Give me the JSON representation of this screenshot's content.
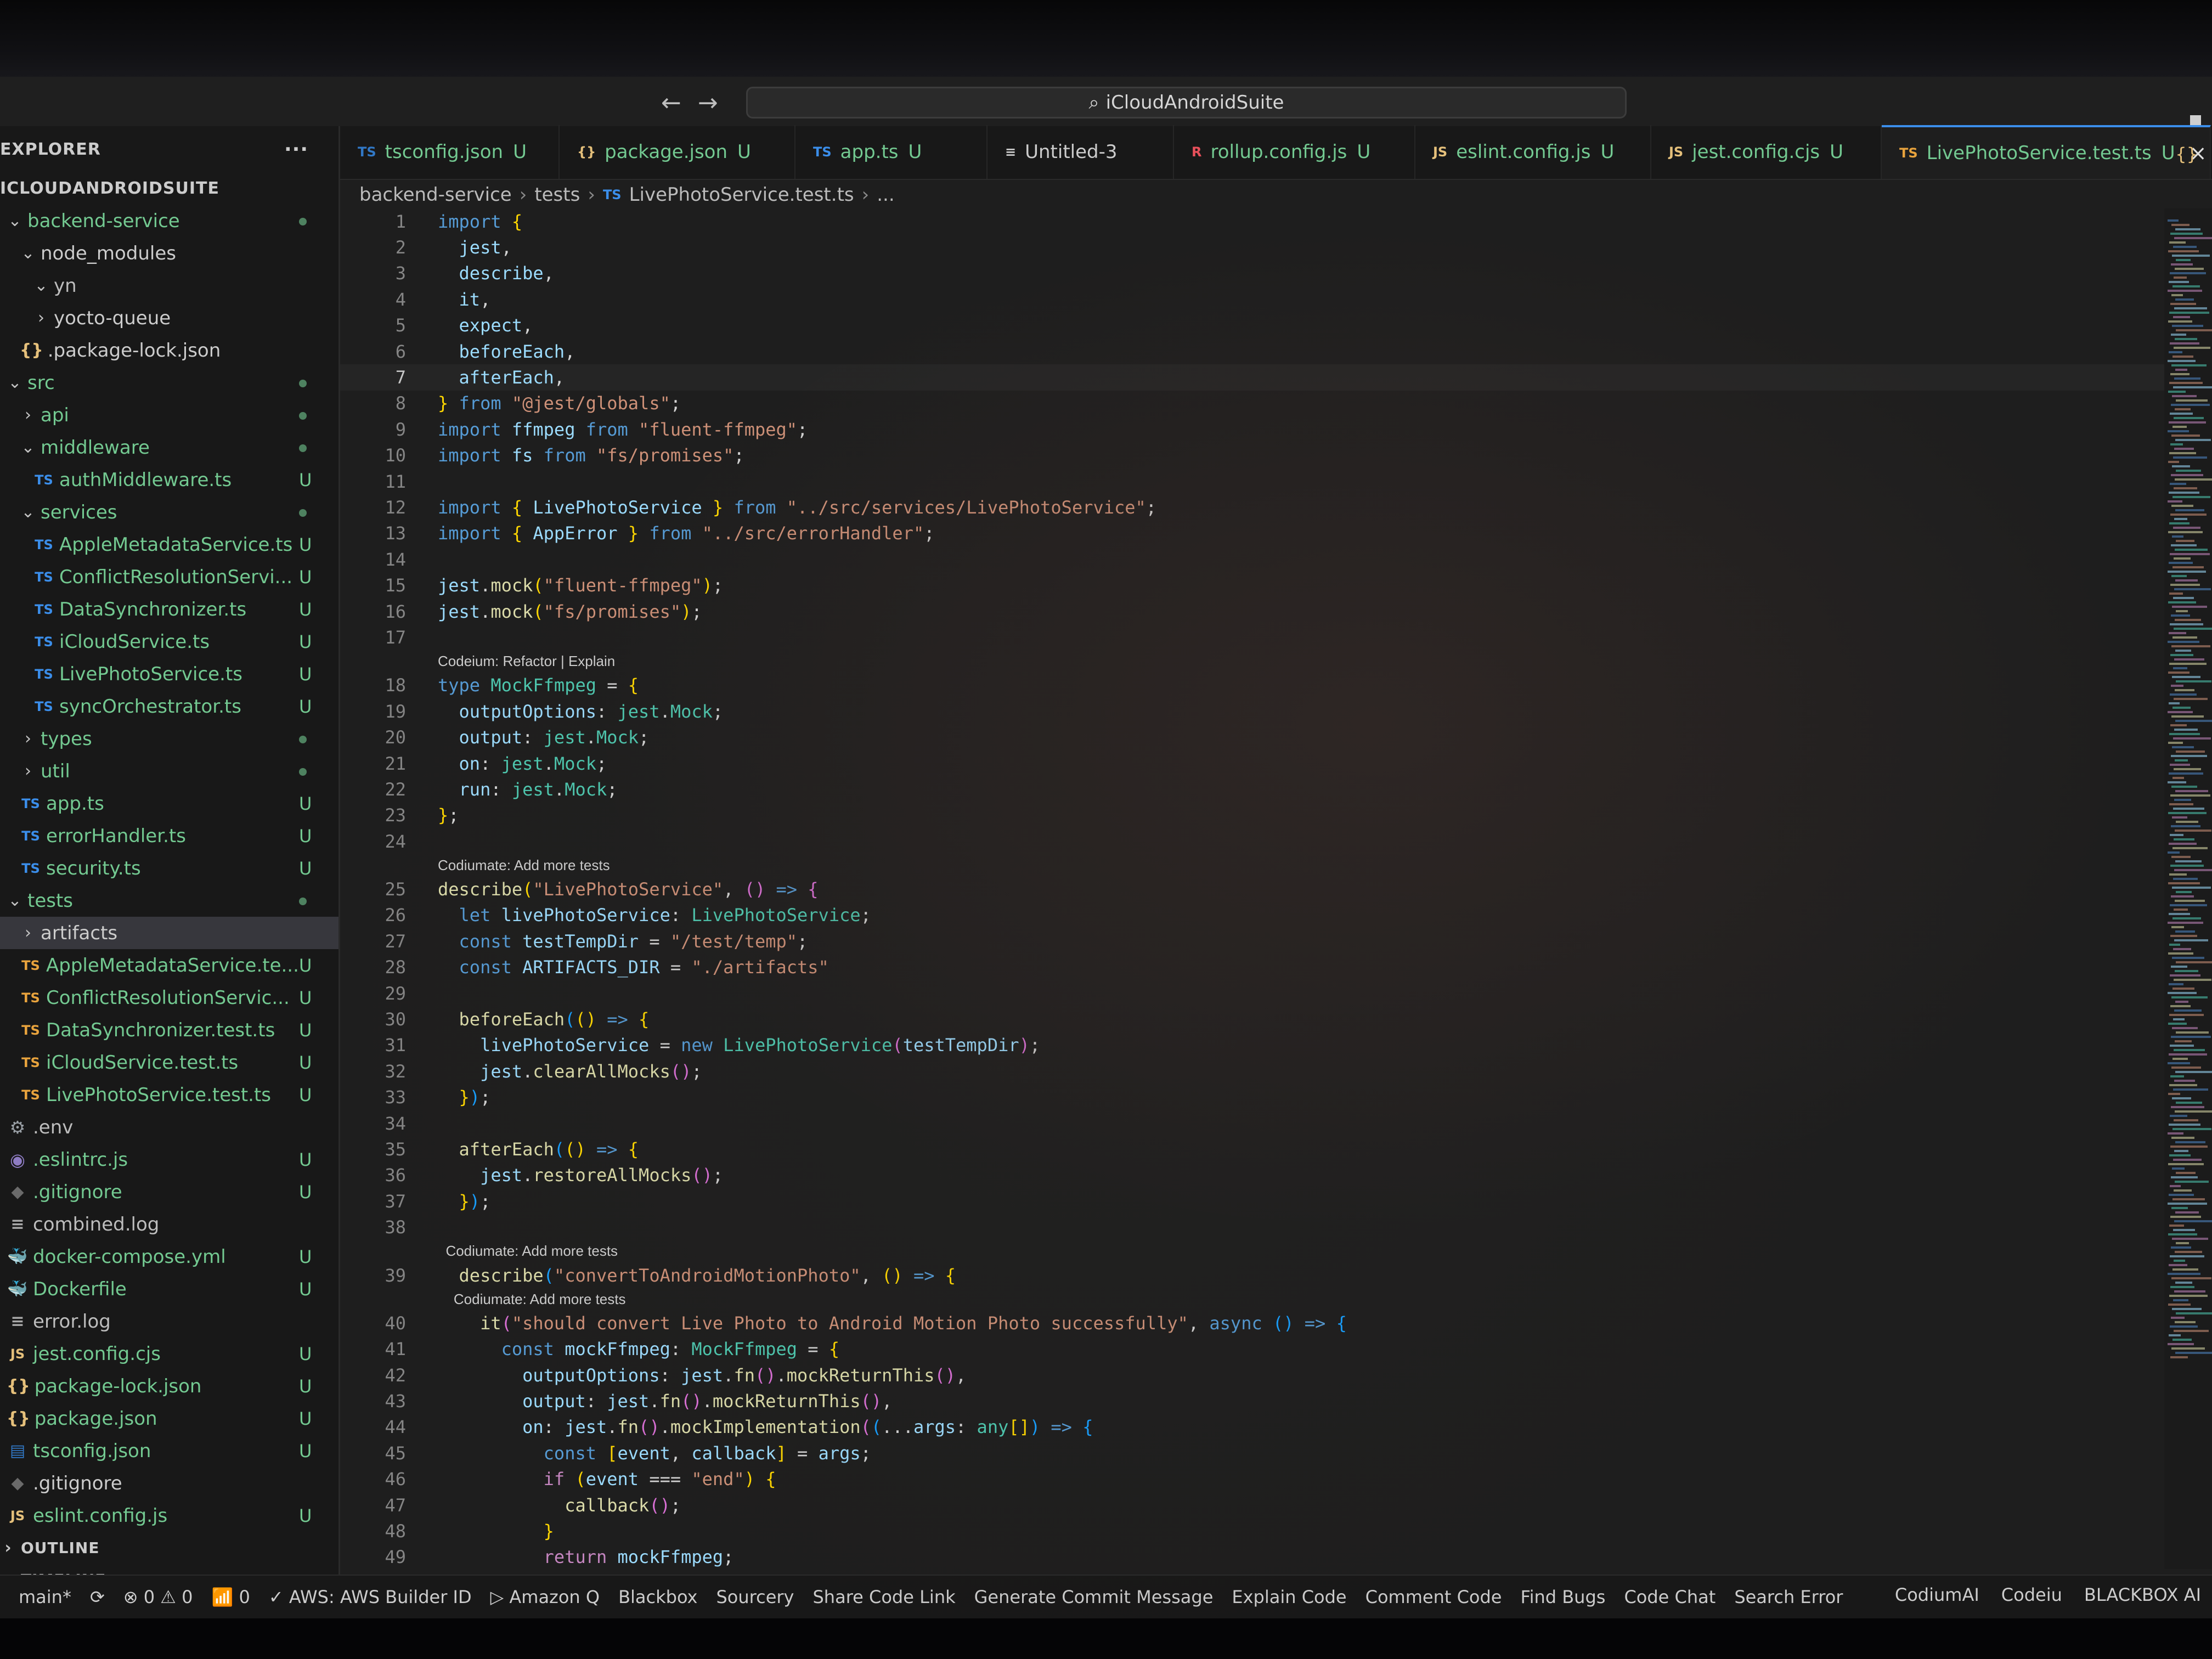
{
  "window": {
    "command_center": "iCloudAndroidSuite",
    "nav_back": "←",
    "nav_forward": "→"
  },
  "explorer": {
    "header": "EXPLORER",
    "more": "···",
    "root": "ICLOUDANDROIDSUITE",
    "items": [
      {
        "label": "backend-service",
        "icon": "chevron-down",
        "depth": 0,
        "status": "dot",
        "color": "green"
      },
      {
        "label": "node_modules",
        "icon": "chevron-down",
        "depth": 1,
        "status": "",
        "color": "plain"
      },
      {
        "label": "yn",
        "icon": "chevron-down",
        "depth": 2,
        "status": "",
        "color": "dim"
      },
      {
        "label": "yocto-queue",
        "icon": "chevron-right",
        "depth": 2,
        "status": "",
        "color": "plain"
      },
      {
        "label": ".package-lock.json",
        "icon": "json",
        "depth": 1,
        "status": "",
        "color": "plain"
      },
      {
        "label": "src",
        "icon": "chevron-down",
        "depth": 0,
        "status": "dot",
        "color": "green"
      },
      {
        "label": "api",
        "icon": "chevron-right",
        "depth": 1,
        "status": "dot",
        "color": "green"
      },
      {
        "label": "middleware",
        "icon": "chevron-down",
        "depth": 1,
        "status": "dot",
        "color": "green"
      },
      {
        "label": "authMiddleware.ts",
        "icon": "ts",
        "depth": 2,
        "status": "U",
        "color": "green"
      },
      {
        "label": "services",
        "icon": "chevron-down",
        "depth": 1,
        "status": "dot",
        "color": "green"
      },
      {
        "label": "AppleMetadataService.ts",
        "icon": "ts",
        "depth": 2,
        "status": "U",
        "color": "green"
      },
      {
        "label": "ConflictResolutionServi...",
        "icon": "ts",
        "depth": 2,
        "status": "U",
        "color": "green"
      },
      {
        "label": "DataSynchronizer.ts",
        "icon": "ts",
        "depth": 2,
        "status": "U",
        "color": "green"
      },
      {
        "label": "iCloudService.ts",
        "icon": "ts",
        "depth": 2,
        "status": "U",
        "color": "green"
      },
      {
        "label": "LivePhotoService.ts",
        "icon": "ts",
        "depth": 2,
        "status": "U",
        "color": "green"
      },
      {
        "label": "syncOrchestrator.ts",
        "icon": "ts",
        "depth": 2,
        "status": "U",
        "color": "green"
      },
      {
        "label": "types",
        "icon": "chevron-right",
        "depth": 1,
        "status": "dot",
        "color": "green"
      },
      {
        "label": "util",
        "icon": "chevron-right",
        "depth": 1,
        "status": "dot",
        "color": "green"
      },
      {
        "label": "app.ts",
        "icon": "ts",
        "depth": 1,
        "status": "U",
        "color": "green"
      },
      {
        "label": "errorHandler.ts",
        "icon": "ts",
        "depth": 1,
        "status": "U",
        "color": "green"
      },
      {
        "label": "security.ts",
        "icon": "ts",
        "depth": 1,
        "status": "U",
        "color": "green"
      },
      {
        "label": "tests",
        "icon": "chevron-down",
        "depth": 0,
        "status": "dot",
        "color": "green"
      },
      {
        "label": "artifacts",
        "icon": "chevron-right",
        "depth": 1,
        "status": "",
        "color": "plain",
        "selected": true
      },
      {
        "label": "AppleMetadataService.te...",
        "icon": "ts-test",
        "depth": 1,
        "status": "U",
        "color": "green"
      },
      {
        "label": "ConflictResolutionServic...",
        "icon": "ts-test",
        "depth": 1,
        "status": "U",
        "color": "green"
      },
      {
        "label": "DataSynchronizer.test.ts",
        "icon": "ts-test",
        "depth": 1,
        "status": "U",
        "color": "green"
      },
      {
        "label": "iCloudService.test.ts",
        "icon": "ts-test",
        "depth": 1,
        "status": "U",
        "color": "green"
      },
      {
        "label": "LivePhotoService.test.ts",
        "icon": "ts-test",
        "depth": 1,
        "status": "U",
        "color": "green"
      },
      {
        "label": ".env",
        "icon": "gear",
        "depth": 0,
        "status": "",
        "color": "dim"
      },
      {
        "label": ".eslintrc.js",
        "icon": "eslint",
        "depth": 0,
        "status": "U",
        "color": "green"
      },
      {
        "label": ".gitignore",
        "icon": "git",
        "depth": 0,
        "status": "U",
        "color": "green"
      },
      {
        "label": "combined.log",
        "icon": "lines",
        "depth": 0,
        "status": "",
        "color": "dim"
      },
      {
        "label": "docker-compose.yml",
        "icon": "docker",
        "depth": 0,
        "status": "U",
        "color": "green"
      },
      {
        "label": "Dockerfile",
        "icon": "dockerfile",
        "depth": 0,
        "status": "U",
        "color": "green"
      },
      {
        "label": "error.log",
        "icon": "lines",
        "depth": 0,
        "status": "",
        "color": "dim"
      },
      {
        "label": "jest.config.cjs",
        "icon": "js",
        "depth": 0,
        "status": "U",
        "color": "green"
      },
      {
        "label": "package-lock.json",
        "icon": "json",
        "depth": 0,
        "status": "U",
        "color": "green"
      },
      {
        "label": "package.json",
        "icon": "json",
        "depth": 0,
        "status": "U",
        "color": "green"
      },
      {
        "label": "tsconfig.json",
        "icon": "tsconfig",
        "depth": 0,
        "status": "U",
        "color": "green"
      },
      {
        "label": ".gitignore",
        "icon": "git",
        "depth": -1,
        "status": "",
        "color": "plain"
      },
      {
        "label": "eslint.config.js",
        "icon": "js",
        "depth": -1,
        "status": "U",
        "color": "green"
      }
    ],
    "outline": "OUTLINE",
    "timeline": "TIMELINE"
  },
  "tabs": [
    {
      "icon": "TS",
      "label": "tsconfig.json",
      "status": "U",
      "kind": "tsconfig"
    },
    {
      "icon": "{}",
      "label": "package.json",
      "status": "U",
      "kind": "json"
    },
    {
      "icon": "TS",
      "label": "app.ts",
      "status": "U",
      "kind": "ts"
    },
    {
      "icon": "≡",
      "label": "Untitled-3",
      "status": "",
      "kind": "untitled"
    },
    {
      "icon": "R",
      "label": "rollup.config.js",
      "status": "U",
      "kind": "rollup"
    },
    {
      "icon": "JS",
      "label": "eslint.config.js",
      "status": "U",
      "kind": "js"
    },
    {
      "icon": "JS",
      "label": "jest.config.cjs",
      "status": "U",
      "kind": "js"
    },
    {
      "icon": "TS",
      "label": "LivePhotoService.test.ts",
      "status": "U",
      "kind": "ts-test",
      "active": true
    }
  ],
  "tab_close": "×",
  "tab_split": "{}",
  "breadcrumb": {
    "parts": [
      "backend-service",
      "tests"
    ],
    "file_icon": "TS",
    "file": "LivePhotoService.test.ts",
    "tail": "..."
  },
  "editor": {
    "lines": [
      {
        "n": "1",
        "html": "<span class='k'>import</span> <span class='b'>{</span>"
      },
      {
        "n": "2",
        "html": "  <span class='v'>jest</span>,"
      },
      {
        "n": "3",
        "html": "  <span class='v'>describe</span>,"
      },
      {
        "n": "4",
        "html": "  <span class='v'>it</span>,"
      },
      {
        "n": "5",
        "html": "  <span class='v'>expect</span>,"
      },
      {
        "n": "6",
        "html": "  <span class='v'>beforeEach</span>,"
      },
      {
        "n": "7",
        "html": "  <span class='v'>afterEach</span>,",
        "current": true
      },
      {
        "n": "8",
        "html": "<span class='b'>}</span> <span class='k'>from</span> <span class='s'>\"@jest/globals\"</span>;"
      },
      {
        "n": "9",
        "html": "<span class='k'>import</span> <span class='v'>ffmpeg</span> <span class='k'>from</span> <span class='s'>\"fluent-ffmpeg\"</span>;"
      },
      {
        "n": "10",
        "html": "<span class='k'>import</span> <span class='v'>fs</span> <span class='k'>from</span> <span class='s'>\"fs/promises\"</span>;"
      },
      {
        "n": "11",
        "html": ""
      },
      {
        "n": "12",
        "html": "<span class='k'>import</span> <span class='b'>{</span> <span class='v'>LivePhotoService</span> <span class='b'>}</span> <span class='k'>from</span> <span class='s'>\"../src/services/LivePhotoService\"</span>;"
      },
      {
        "n": "13",
        "html": "<span class='k'>import</span> <span class='b'>{</span> <span class='v'>AppError</span> <span class='b'>}</span> <span class='k'>from</span> <span class='s'>\"../src/errorHandler\"</span>;"
      },
      {
        "n": "14",
        "html": ""
      },
      {
        "n": "15",
        "html": "<span class='v'>jest</span>.<span class='f'>mock</span><span class='b'>(</span><span class='s'>\"fluent-ffmpeg\"</span><span class='b'>)</span>;"
      },
      {
        "n": "16",
        "html": "<span class='v'>jest</span>.<span class='f'>mock</span><span class='b'>(</span><span class='s'>\"fs/promises\"</span><span class='b'>)</span>;"
      },
      {
        "n": "17",
        "html": ""
      },
      {
        "n": "",
        "lens": "Codeium: Refactor | Explain"
      },
      {
        "n": "18",
        "html": "<span class='k'>type</span> <span class='t'>MockFfmpeg</span> = <span class='b'>{</span>"
      },
      {
        "n": "19",
        "html": "  <span class='v'>outputOptions</span>: <span class='t'>jest</span>.<span class='t'>Mock</span>;"
      },
      {
        "n": "20",
        "html": "  <span class='v'>output</span>: <span class='t'>jest</span>.<span class='t'>Mock</span>;"
      },
      {
        "n": "21",
        "html": "  <span class='v'>on</span>: <span class='t'>jest</span>.<span class='t'>Mock</span>;"
      },
      {
        "n": "22",
        "html": "  <span class='v'>run</span>: <span class='t'>jest</span>.<span class='t'>Mock</span>;"
      },
      {
        "n": "23",
        "html": "<span class='b'>}</span>;"
      },
      {
        "n": "24",
        "html": ""
      },
      {
        "n": "",
        "lens": "Codiumate: Add more tests"
      },
      {
        "n": "25",
        "html": "<span class='f'>describe</span><span class='b'>(</span><span class='s'>\"LivePhotoService\"</span>, <span class='b2'>()</span> <span class='k'>=&gt;</span> <span class='b2'>{</span>"
      },
      {
        "n": "26",
        "html": "  <span class='k'>let</span> <span class='v'>livePhotoService</span>: <span class='t'>LivePhotoService</span>;"
      },
      {
        "n": "27",
        "html": "  <span class='k'>const</span> <span class='v'>testTempDir</span> = <span class='s'>\"/test/temp\"</span>;"
      },
      {
        "n": "28",
        "html": "  <span class='k'>const</span> <span class='v'>ARTIFACTS_DIR</span> = <span class='s'>\"./artifacts\"</span>"
      },
      {
        "n": "29",
        "html": ""
      },
      {
        "n": "30",
        "html": "  <span class='f'>beforeEach</span><span class='b3'>(</span><span class='b'>()</span> <span class='k'>=&gt;</span> <span class='b'>{</span>"
      },
      {
        "n": "31",
        "html": "    <span class='v'>livePhotoService</span> = <span class='k'>new</span> <span class='t'>LivePhotoService</span><span class='b2'>(</span><span class='v'>testTempDir</span><span class='b2'>)</span>;"
      },
      {
        "n": "32",
        "html": "    <span class='v'>jest</span>.<span class='f'>clearAllMocks</span><span class='b2'>()</span>;"
      },
      {
        "n": "33",
        "html": "  <span class='b'>}</span><span class='b3'>)</span>;"
      },
      {
        "n": "34",
        "html": ""
      },
      {
        "n": "35",
        "html": "  <span class='f'>afterEach</span><span class='b3'>(</span><span class='b'>()</span> <span class='k'>=&gt;</span> <span class='b'>{</span>"
      },
      {
        "n": "36",
        "html": "    <span class='v'>jest</span>.<span class='f'>restoreAllMocks</span><span class='b2'>()</span>;"
      },
      {
        "n": "37",
        "html": "  <span class='b'>}</span><span class='b3'>)</span>;"
      },
      {
        "n": "38",
        "html": ""
      },
      {
        "n": "",
        "lens": "  Codiumate: Add more tests"
      },
      {
        "n": "39",
        "html": "  <span class='f'>describe</span><span class='b3'>(</span><span class='s'>\"convertToAndroidMotionPhoto\"</span>, <span class='b'>()</span> <span class='k'>=&gt;</span> <span class='b'>{</span>"
      },
      {
        "n": "",
        "lens": "    Codiumate: Add more tests"
      },
      {
        "n": "40",
        "html": "    <span class='f'>it</span><span class='b2'>(</span><span class='s'>\"should convert Live Photo to Android Motion Photo successfully\"</span>, <span class='k'>async</span> <span class='b3'>()</span> <span class='k'>=&gt;</span> <span class='b3'>{</span>"
      },
      {
        "n": "41",
        "html": "      <span class='k'>const</span> <span class='v'>mockFfmpeg</span>: <span class='t'>MockFfmpeg</span> = <span class='b'>{</span>"
      },
      {
        "n": "42",
        "html": "        <span class='v'>outputOptions</span>: <span class='v'>jest</span>.<span class='f'>fn</span><span class='b2'>()</span>.<span class='f'>mockReturnThis</span><span class='b2'>()</span>,"
      },
      {
        "n": "43",
        "html": "        <span class='v'>output</span>: <span class='v'>jest</span>.<span class='f'>fn</span><span class='b2'>()</span>.<span class='f'>mockReturnThis</span><span class='b2'>()</span>,"
      },
      {
        "n": "44",
        "html": "        <span class='v'>on</span>: <span class='v'>jest</span>.<span class='f'>fn</span><span class='b2'>()</span>.<span class='f'>mockImplementation</span><span class='b2'>(</span><span class='b3'>(</span>...<span class='v'>args</span>: <span class='t'>any</span><span class='b'>[]</span><span class='b3'>)</span> <span class='k'>=&gt;</span> <span class='b3'>{</span>"
      },
      {
        "n": "45",
        "html": "          <span class='k'>const</span> <span class='b'>[</span><span class='v'>event</span>, <span class='v'>callback</span><span class='b'>]</span> = <span class='v'>args</span>;"
      },
      {
        "n": "46",
        "html": "          <span class='kc'>if</span> <span class='b'>(</span><span class='v'>event</span> === <span class='s'>\"end\"</span><span class='b'>)</span> <span class='b'>{</span>"
      },
      {
        "n": "47",
        "html": "            <span class='f'>callback</span><span class='b2'>()</span>;"
      },
      {
        "n": "48",
        "html": "          <span class='b'>}</span>"
      },
      {
        "n": "49",
        "html": "          <span class='kc'>return</span> <span class='v'>mockFfmpeg</span>;"
      }
    ]
  },
  "statusbar": {
    "left": [
      {
        "id": "branch",
        "label": "main*"
      },
      {
        "id": "sync",
        "label": "⟳"
      },
      {
        "id": "problems",
        "label": "⊗ 0 ⚠ 0"
      },
      {
        "id": "ports",
        "label": "📶 0"
      },
      {
        "id": "aws",
        "label": "✓ AWS: AWS Builder ID"
      },
      {
        "id": "amazonq",
        "label": "▷ Amazon Q"
      },
      {
        "id": "blackbox",
        "label": "Blackbox"
      },
      {
        "id": "sourcery",
        "label": "Sourcery"
      },
      {
        "id": "share",
        "label": "Share Code Link"
      },
      {
        "id": "commit",
        "label": "Generate Commit Message"
      },
      {
        "id": "explain",
        "label": "Explain Code"
      },
      {
        "id": "comment",
        "label": "Comment Code"
      },
      {
        "id": "bugs",
        "label": "Find Bugs"
      },
      {
        "id": "chat",
        "label": "Code Chat"
      },
      {
        "id": "search",
        "label": "Search Error"
      }
    ],
    "right": [
      {
        "id": "codiumai",
        "label": "CodiumAI"
      },
      {
        "id": "codeium",
        "label": "Codeiu"
      },
      {
        "id": "blackboxai",
        "label": "BLACKBOX AI"
      }
    ]
  },
  "colors": {
    "editor_bg": "#1e1e1e",
    "sidebar_bg": "#181818",
    "git_untracked": "#73c991",
    "accent": "#3b8eea"
  }
}
